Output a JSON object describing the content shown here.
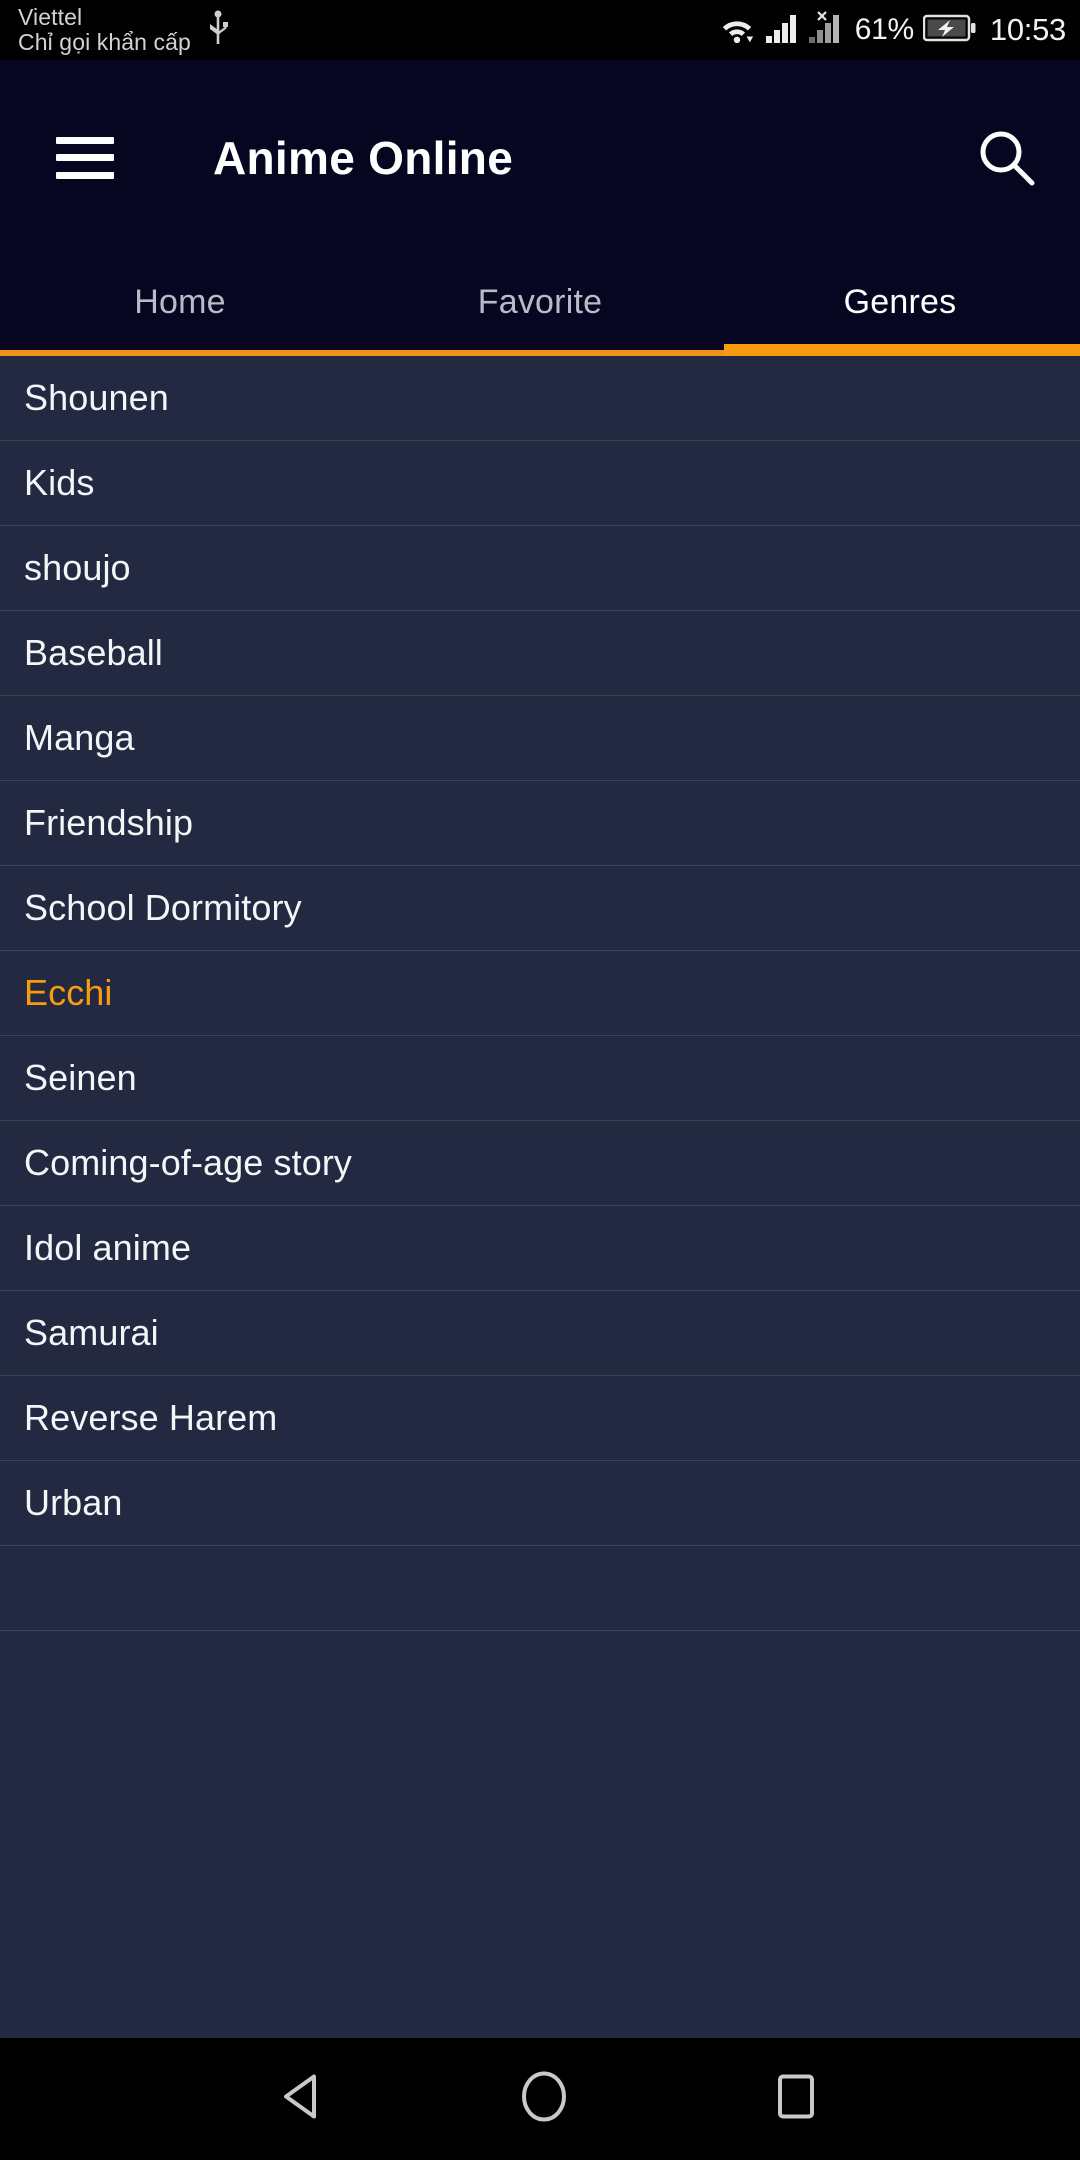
{
  "status_bar": {
    "carrier": "Viettel",
    "carrier_sub": "Chỉ gọi khẩn cấp",
    "usb_icon": "usb-icon",
    "wifi_icon": "wifi-icon",
    "signal_icon": "signal-bars-icon",
    "signal_no_sim_icon": "signal-no-sim-icon",
    "battery_percent": "61%",
    "battery_icon": "battery-charging-icon",
    "clock": "10:53"
  },
  "app_bar": {
    "menu_icon": "hamburger-menu-icon",
    "title": "Anime Online",
    "search_icon": "search-icon",
    "background_color": "#060620",
    "title_color": "#ffffff"
  },
  "tabs": {
    "items": [
      {
        "label": "Home",
        "active": false
      },
      {
        "label": "Favorite",
        "active": false
      },
      {
        "label": "Genres",
        "active": true
      }
    ],
    "indicator_color": "#f79c11",
    "inactive_color": "#b9bcc6",
    "active_color": "#ffffff"
  },
  "genre_list": {
    "background_color": "#222941",
    "divider_color": "#3b4157",
    "text_color": "#f4f5f7",
    "highlight_color": "#f79c11",
    "items": [
      {
        "label": "Shounen",
        "highlight": false
      },
      {
        "label": "Kids",
        "highlight": false
      },
      {
        "label": "shoujo",
        "highlight": false
      },
      {
        "label": "Baseball",
        "highlight": false
      },
      {
        "label": "Manga",
        "highlight": false
      },
      {
        "label": "Friendship",
        "highlight": false
      },
      {
        "label": "School Dormitory",
        "highlight": false
      },
      {
        "label": "Ecchi",
        "highlight": true
      },
      {
        "label": "Seinen",
        "highlight": false
      },
      {
        "label": "Coming-of-age story",
        "highlight": false
      },
      {
        "label": "Idol anime",
        "highlight": false
      },
      {
        "label": "Samurai",
        "highlight": false
      },
      {
        "label": "Reverse Harem",
        "highlight": false
      },
      {
        "label": "Urban",
        "highlight": false
      },
      {
        "label": "",
        "highlight": false
      }
    ]
  },
  "nav_bar": {
    "back_icon": "back-triangle-icon",
    "home_icon": "home-circle-icon",
    "recents_icon": "recents-square-icon",
    "background_color": "#000000",
    "icon_color": "#c9c9c9"
  }
}
